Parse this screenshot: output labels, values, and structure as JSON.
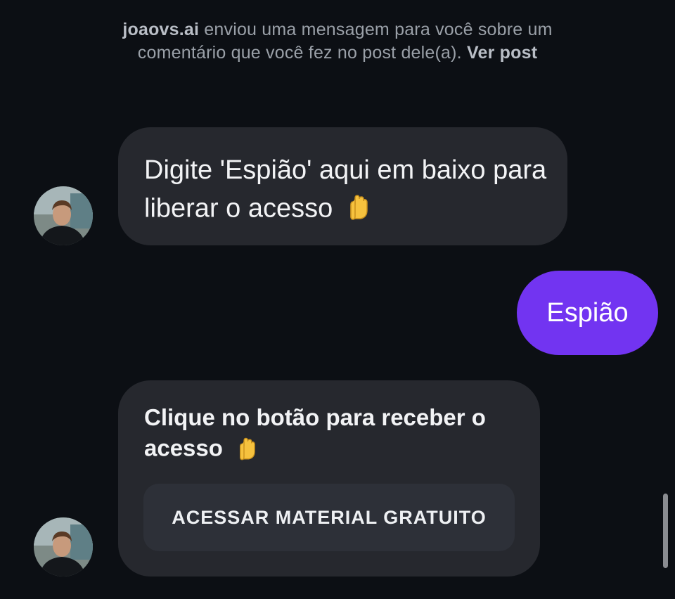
{
  "notice": {
    "sender": "joaovs.ai",
    "text": " enviou uma mensagem para você sobre um comentário que você fez no post dele(a). ",
    "link": "Ver post"
  },
  "messages": {
    "incoming_1": "Digite 'Espião' aqui em baixo para liberar o acesso",
    "outgoing_1": "Espião",
    "incoming_2": "Clique no botão para receber o acesso",
    "button_label": "ACESSAR MATERIAL GRATUITO"
  },
  "icons": {
    "avatar": "profile-photo",
    "emoji": "backhand-index-pointing-down"
  },
  "colors": {
    "background": "#0c0f14",
    "incoming_bubble": "#26282e",
    "outgoing_bubble": "#7234f1",
    "button": "#2d3038"
  }
}
